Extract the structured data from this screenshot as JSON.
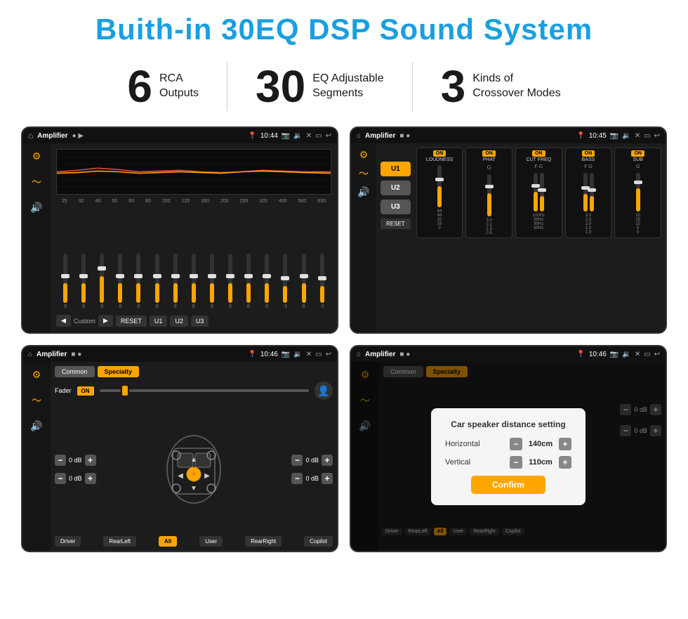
{
  "page": {
    "title": "Buith-in 30EQ DSP Sound System",
    "stats": [
      {
        "number": "6",
        "text": "RCA\nOutputs"
      },
      {
        "number": "30",
        "text": "EQ Adjustable\nSegments"
      },
      {
        "number": "3",
        "text": "Kinds of\nCrossover Modes"
      }
    ]
  },
  "screens": {
    "screen1": {
      "title": "Amplifier",
      "time": "10:44",
      "freq_labels": [
        "25",
        "32",
        "40",
        "50",
        "63",
        "80",
        "100",
        "125",
        "160",
        "200",
        "250",
        "320",
        "400",
        "500",
        "630"
      ],
      "bottom_buttons": [
        "◀",
        "Custom",
        "▶",
        "RESET",
        "U1",
        "U2",
        "U3"
      ]
    },
    "screen2": {
      "title": "Amplifier",
      "time": "10:45",
      "user_btns": [
        "U1",
        "U2",
        "U3"
      ],
      "channels": [
        {
          "on": true,
          "name": "LOUDNESS"
        },
        {
          "on": true,
          "name": "PHAT"
        },
        {
          "on": true,
          "name": "CUT FREQ"
        },
        {
          "on": true,
          "name": "BASS"
        },
        {
          "on": true,
          "name": "SUB"
        }
      ],
      "reset_label": "RESET"
    },
    "screen3": {
      "title": "Amplifier",
      "time": "10:46",
      "tab_common": "Common",
      "tab_specialty": "Specialty",
      "fader_label": "Fader",
      "on_label": "ON",
      "db_values": [
        "0 dB",
        "0 dB",
        "0 dB",
        "0 dB"
      ],
      "buttons": [
        "Driver",
        "RearLeft",
        "All",
        "User",
        "RearRight",
        "Copilot"
      ]
    },
    "screen4": {
      "title": "Amplifier",
      "time": "10:46",
      "tab_common": "Common",
      "tab_specialty": "Specialty",
      "dialog": {
        "title": "Car speaker distance setting",
        "horizontal_label": "Horizontal",
        "horizontal_value": "140cm",
        "vertical_label": "Vertical",
        "vertical_value": "110cm",
        "confirm_label": "Confirm",
        "minus_label": "−",
        "plus_label": "+"
      },
      "db_values": [
        "0 dB",
        "0 dB"
      ],
      "buttons": [
        "Driver",
        "RearLeft",
        "All",
        "User",
        "RearRight",
        "Copilot"
      ]
    }
  },
  "icons": {
    "home": "⌂",
    "settings": "⚙",
    "equalizer": "≡",
    "speaker": "🔊",
    "back": "↩",
    "pin": "📍",
    "camera": "📷",
    "vol": "🔉"
  }
}
